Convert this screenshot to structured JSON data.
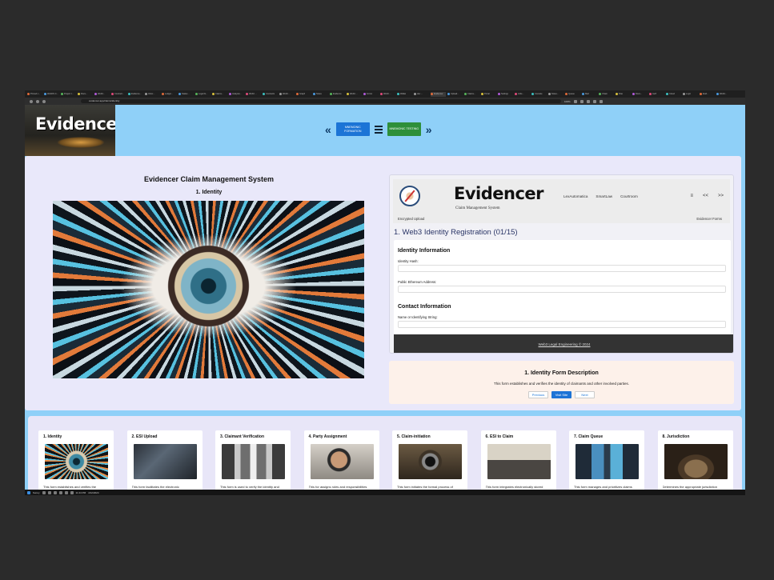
{
  "browser": {
    "tabs": [
      "Pinned c...",
      "WebOS C...",
      "Project I...",
      "Docs...",
      "Web3...",
      "Contract...",
      "Evidence...",
      "Inbox...",
      "Ledger...",
      "Status...",
      "Legal fo...",
      "Claims...",
      "Analysis...",
      "Web3 ...",
      "Contracts",
      "Web3 ...",
      "Graph",
      "Notes",
      "Evidence",
      "Web3 ...",
      "Forms",
      "Web3 ...",
      "Wallet",
      "dev ...",
      "Evidencer",
      "Upload...",
      "Claims...",
      "Portal",
      "Settings",
      "Jobs...",
      "Console",
      "Notes...",
      "Queue",
      "Mail",
      "Chain",
      "Files",
      "Docs...",
      "Auth",
      "Cloud",
      "Login",
      "Evid...",
      "Web3..."
    ],
    "url": "evidencer.app/claims/identity",
    "zoom": "100%"
  },
  "site": {
    "logo": "Evidencer",
    "nav": {
      "prev_icon": "«",
      "formation_label": "MNEMONIC FORMATION",
      "testing_label": "MNEMONIC TESTING",
      "next_icon": "»"
    }
  },
  "main": {
    "title": "Evidencer Claim Management System",
    "subtitle": "1. Identity"
  },
  "form_panel": {
    "logo": "Evidencer",
    "tagline": "Claim Management System",
    "links": [
      "LexAutomatica",
      "SmartLaw",
      "Courtroom"
    ],
    "controls": [
      "≡",
      "<<",
      ">>"
    ],
    "left_label": "Encrypted Upload",
    "right_label": "Evidencer Forms",
    "title": "1. Web3 Identity Registration (01/15)",
    "section1": "Identity Information",
    "field1_label": "Identity Hash:",
    "field2_label": "Public Ethereum Address:",
    "section2": "Contact Information",
    "field3_label": "Name or Identifying String:",
    "footer": "Web3 Legal Engineering © 2024"
  },
  "description": {
    "title": "1. Identity Form Description",
    "text": "This form establishes and verifies the identity of claimants and other involved parties.",
    "prev": "Previous",
    "visit": "Visit Site",
    "next": "Next"
  },
  "cards": [
    {
      "title": "1. Identity",
      "text": "This form establishes and verifies the",
      "scene": "eye"
    },
    {
      "title": "2. ESI Upload",
      "text": "This form facilitates the electronic",
      "scene": "devices"
    },
    {
      "title": "3. Claimant Verification",
      "text": "This form is used to verify the identity and",
      "scene": "corridor"
    },
    {
      "title": "4. Party Assignment",
      "text": "This for assigns roles and responsibilities",
      "scene": "portrait"
    },
    {
      "title": "5. Claim-initiation",
      "text": "This form initiates the formal process of",
      "scene": "vault"
    },
    {
      "title": "6. ESI to Claim",
      "text": "This form integrates electronically stored",
      "scene": "table"
    },
    {
      "title": "7. Claim Queue",
      "text": "This form manages and prioritizes claims",
      "scene": "monitors"
    },
    {
      "title": "8. Jurisdiction",
      "text": "Determines the appropriate jurisdiction",
      "scene": "chamber"
    }
  ],
  "taskbar": {
    "weather": "Sunny",
    "time": "11:24 PM",
    "date": "4/12/2024"
  }
}
